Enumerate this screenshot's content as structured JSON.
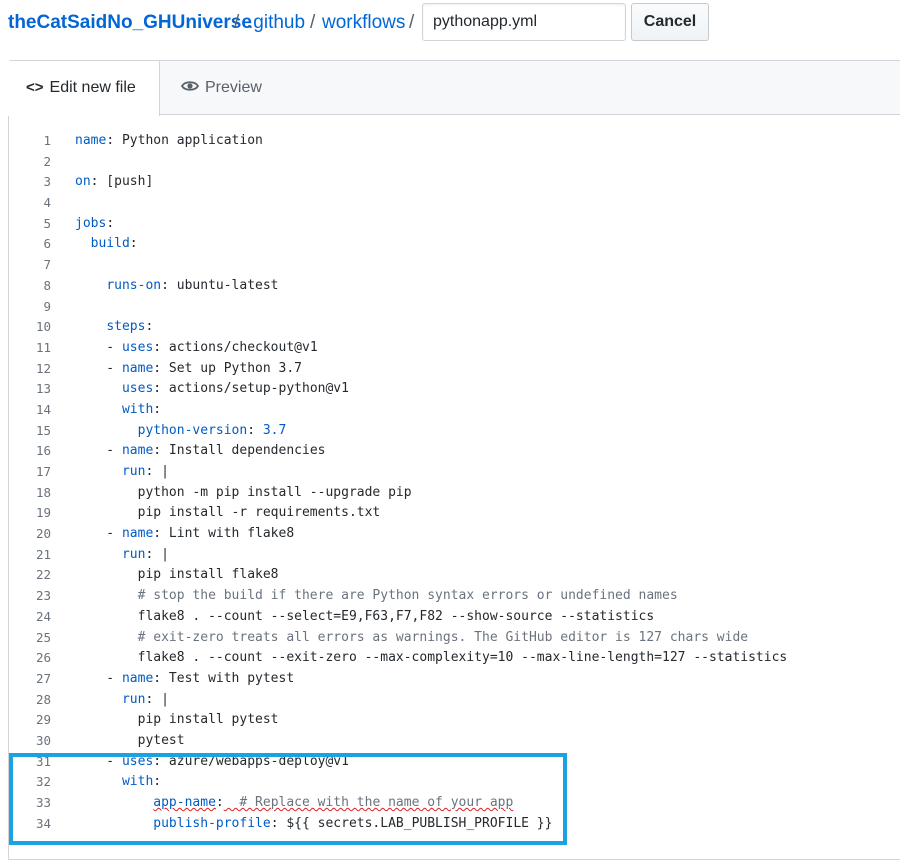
{
  "breadcrumb": {
    "repo": "theCatSaidNo_GHUniverse",
    "sep1": "/",
    "dir1": ".github",
    "sep2": "/",
    "dir2": "workflows",
    "sep3": "/"
  },
  "filename": {
    "value": "pythonapp.yml"
  },
  "cancel_label": "Cancel",
  "tabs": {
    "edit": {
      "glyph": "<>",
      "label": "Edit new file",
      "icon": "code-icon"
    },
    "preview": {
      "label": "Preview",
      "icon": "eye-icon"
    }
  },
  "colors": {
    "link": "#0366d6",
    "key": "#005cc5",
    "comment": "#6a737d",
    "highlight": "#1aa3e0",
    "squiggle": "#e11d21"
  },
  "code_lines": [
    {
      "n": "1",
      "indent": "",
      "key": "name",
      "val": " Python application"
    },
    {
      "n": "2",
      "indent": "",
      "key": "",
      "val": ""
    },
    {
      "n": "3",
      "indent": "",
      "key": "on",
      "val": " [push]"
    },
    {
      "n": "4",
      "indent": "",
      "key": "",
      "val": ""
    },
    {
      "n": "5",
      "indent": "",
      "key": "jobs",
      "val": ""
    },
    {
      "n": "6",
      "indent": "  ",
      "key": "build",
      "val": ""
    },
    {
      "n": "7",
      "indent": "",
      "key": "",
      "val": ""
    },
    {
      "n": "8",
      "indent": "    ",
      "key": "runs-on",
      "val": " ubuntu-latest"
    },
    {
      "n": "9",
      "indent": "",
      "key": "",
      "val": ""
    },
    {
      "n": "10",
      "indent": "    ",
      "key": "steps",
      "val": ""
    },
    {
      "n": "11",
      "indent": "    - ",
      "key": "uses",
      "val": " actions/checkout@v1"
    },
    {
      "n": "12",
      "indent": "    - ",
      "key": "name",
      "val": " Set up Python 3.7"
    },
    {
      "n": "13",
      "indent": "      ",
      "key": "uses",
      "val": " actions/setup-python@v1"
    },
    {
      "n": "14",
      "indent": "      ",
      "key": "with",
      "val": ""
    },
    {
      "n": "15",
      "indent": "        ",
      "key": "python-version",
      "val": " 3.7",
      "valkey": true
    },
    {
      "n": "16",
      "indent": "    - ",
      "key": "name",
      "val": " Install dependencies"
    },
    {
      "n": "17",
      "indent": "      ",
      "key": "run",
      "val": " |"
    },
    {
      "n": "18",
      "indent": "        ",
      "key": "",
      "val": "python -m pip install --upgrade pip"
    },
    {
      "n": "19",
      "indent": "        ",
      "key": "",
      "val": "pip install -r requirements.txt"
    },
    {
      "n": "20",
      "indent": "    - ",
      "key": "name",
      "val": " Lint with flake8"
    },
    {
      "n": "21",
      "indent": "      ",
      "key": "run",
      "val": " |"
    },
    {
      "n": "22",
      "indent": "        ",
      "key": "",
      "val": "pip install flake8"
    },
    {
      "n": "23",
      "indent": "        ",
      "key": "",
      "val": "# stop the build if there are Python syntax errors or undefined names"
    },
    {
      "n": "24",
      "indent": "        ",
      "key": "",
      "val": "flake8 . --count --select=E9,F63,F7,F82 --show-source --statistics"
    },
    {
      "n": "25",
      "indent": "        ",
      "key": "",
      "val": "# exit-zero treats all errors as warnings. The GitHub editor is 127 chars wide"
    },
    {
      "n": "26",
      "indent": "        ",
      "key": "",
      "val": "flake8 . --count --exit-zero --max-complexity=10 --max-line-length=127 --statistics"
    },
    {
      "n": "27",
      "indent": "    - ",
      "key": "name",
      "val": " Test with pytest"
    },
    {
      "n": "28",
      "indent": "      ",
      "key": "run",
      "val": " |"
    },
    {
      "n": "29",
      "indent": "        ",
      "key": "",
      "val": "pip install pytest"
    },
    {
      "n": "30",
      "indent": "        ",
      "key": "",
      "val": "pytest"
    },
    {
      "n": "31",
      "indent": "    - ",
      "key": "uses",
      "val": " azure/webapps-deploy@v1"
    },
    {
      "n": "32",
      "indent": "      ",
      "key": "with",
      "val": ""
    },
    {
      "n": "33",
      "indent": "          ",
      "key": "app-name",
      "val": "  # Replace with the name of your app",
      "comment": true,
      "squiggle": true
    },
    {
      "n": "34",
      "indent": "          ",
      "key": "publish-profile",
      "val": " ${{ secrets.LAB_PUBLISH_PROFILE }}"
    }
  ]
}
